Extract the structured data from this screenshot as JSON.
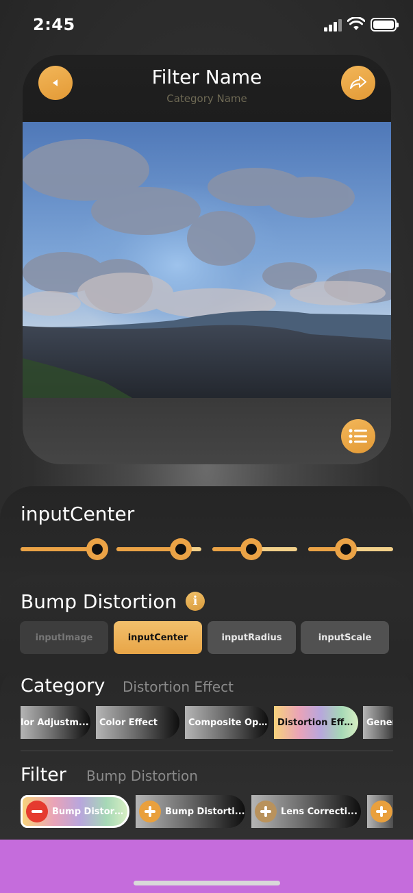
{
  "status_bar": {
    "time": "2:45"
  },
  "preview": {
    "title": "Filter Name",
    "category": "Category Name"
  },
  "input_panel": {
    "parameter_name": "inputCenter",
    "sliders": [
      {
        "value": 0.9
      },
      {
        "value": 0.76
      },
      {
        "value": 0.46
      },
      {
        "value": 0.44
      }
    ]
  },
  "filter_panel": {
    "filter_name": "Bump Distortion",
    "tabs": [
      {
        "label": "inputImage",
        "state": "disabled"
      },
      {
        "label": "inputCenter",
        "state": "active"
      },
      {
        "label": "inputRadius",
        "state": "normal"
      },
      {
        "label": "inputScale",
        "state": "normal"
      }
    ]
  },
  "category_section": {
    "title": "Category",
    "selected": "Distortion Effect",
    "chips": [
      "lor Adjustm...",
      "Color Effect",
      "Composite Op...",
      "Distortion Effe...",
      "Gener"
    ]
  },
  "filter_section": {
    "title": "Filter",
    "selected": "Bump Distortion",
    "chips": [
      "Bump Distortion",
      "Bump Distorti...",
      "Lens Correcti..."
    ]
  },
  "colors": {
    "accent": "#eba346",
    "remove": "#e53b2f",
    "bottom_bar": "#c56cdc"
  }
}
